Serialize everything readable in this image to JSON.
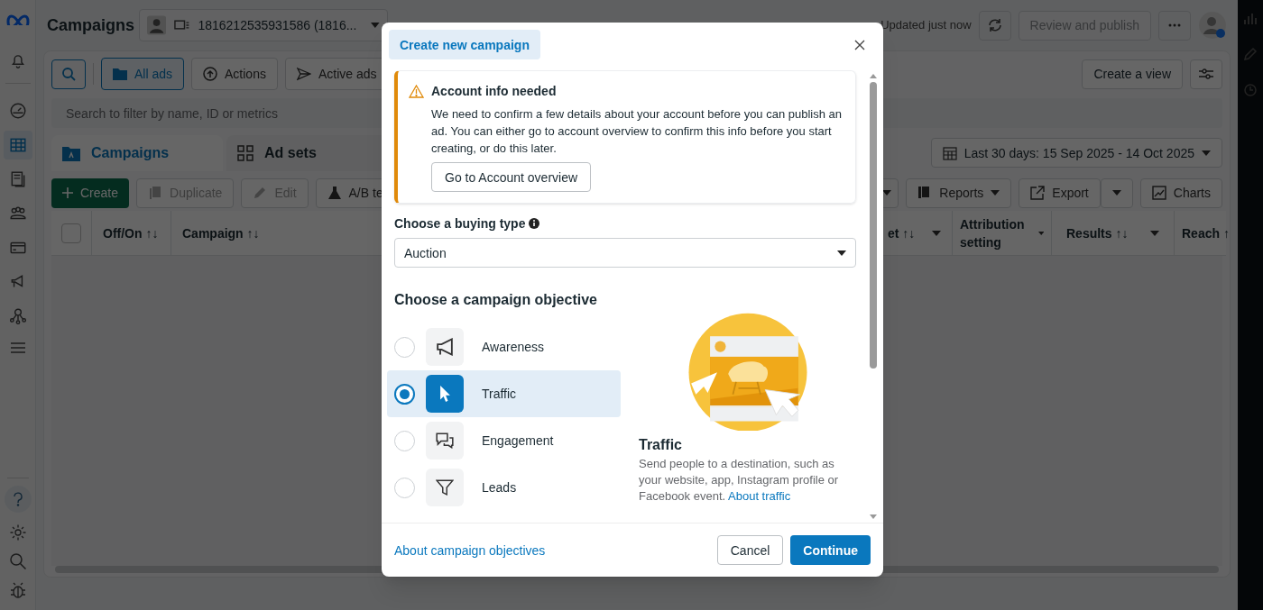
{
  "sidebar": {
    "items": [
      {
        "selected": false
      },
      {
        "selected": false
      },
      {
        "selected": true
      },
      {
        "selected": false
      },
      {
        "selected": false
      },
      {
        "selected": false
      },
      {
        "selected": false
      },
      {
        "selected": false
      }
    ]
  },
  "header": {
    "title": "Campaigns",
    "account": "1816212535931586 (1816...",
    "status": "Updated just now",
    "publish_button": "Review and publish"
  },
  "toolbar": {
    "filters": [
      {
        "label": "All ads",
        "selected": true
      },
      {
        "label": "Actions",
        "selected": false
      },
      {
        "label": "Active ads",
        "selected": false
      }
    ],
    "create_view": "Create a view"
  },
  "search": {
    "placeholder": "Search to filter by name, ID or metrics"
  },
  "tabs": [
    {
      "label": "Campaigns",
      "selected": true
    },
    {
      "label": "Ad sets",
      "selected": false
    }
  ],
  "date_range": "Last 30 days: 15 Sep 2025 - 14 Oct 2025",
  "actions": {
    "create": "Create",
    "left": [
      "Duplicate",
      "Edit",
      "A/B te"
    ],
    "right": [
      "Reports",
      "Export",
      "Charts"
    ]
  },
  "table": {
    "select_all": {
      "checked": false
    },
    "columns": [
      "Off/On ↑↓",
      "Campaign ↑↓"
    ],
    "right_columns": [
      "et ↑↓",
      "Attribution setting",
      "Results ↑↓",
      "Reach ↑"
    ]
  },
  "modal": {
    "title": "Create new campaign",
    "alert": {
      "title": "Account info needed",
      "text": "We need to confirm a few details about your account before you can publish an ad. You can either go to account overview to confirm this info before you start creating, or do this later.",
      "button": "Go to Account overview"
    },
    "buying_label": "Choose a buying type",
    "buying_type": "Auction",
    "objective_heading": "Choose a campaign objective",
    "objectives": [
      {
        "label": "Awareness",
        "selected": false
      },
      {
        "label": "Traffic",
        "selected": true
      },
      {
        "label": "Engagement",
        "selected": false
      },
      {
        "label": "Leads",
        "selected": false
      }
    ],
    "detail": {
      "title": "Traffic",
      "text": "Send people to a destination, such as your website, app, Instagram profile or Facebook event.",
      "link": "About traffic"
    },
    "footer_link": "About campaign objectives",
    "cancel": "Cancel",
    "continue": "Continue"
  }
}
